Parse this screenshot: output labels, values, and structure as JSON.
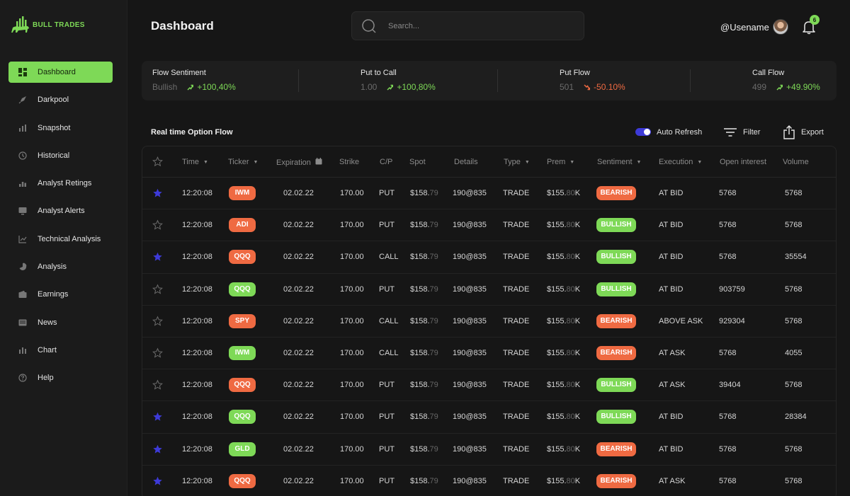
{
  "brand": {
    "name": "BULL TRADES"
  },
  "colors": {
    "accent": "#7ed957",
    "bearish": "#ef6a42",
    "star": "#3d3ad8",
    "toggle": "#3d3ad8"
  },
  "sidebar": {
    "items": [
      {
        "label": "Dashboard",
        "icon": "dashboard-icon",
        "active": true
      },
      {
        "label": "Darkpool",
        "icon": "rocket-icon"
      },
      {
        "label": "Snapshot",
        "icon": "bar-chart-icon"
      },
      {
        "label": "Historical",
        "icon": "clock-icon"
      },
      {
        "label": "Analyst Retings",
        "icon": "analyst-icon"
      },
      {
        "label": "Analyst Alerts",
        "icon": "alert-icon"
      },
      {
        "label": "Technical Analysis",
        "icon": "line-chart-icon"
      },
      {
        "label": "Analysis",
        "icon": "pie-chart-icon"
      },
      {
        "label": "Earnings",
        "icon": "wallet-icon"
      },
      {
        "label": "News",
        "icon": "news-icon"
      },
      {
        "label": "Chart",
        "icon": "chart-icon"
      },
      {
        "label": "Help",
        "icon": "help-icon"
      }
    ]
  },
  "header": {
    "title": "Dashboard",
    "search_placeholder": "Search...",
    "username": "@Usename",
    "notification_count": "6"
  },
  "stats": [
    {
      "label": "Flow Sentiment",
      "value": "Bullish",
      "change": "+100,40%",
      "direction": "up"
    },
    {
      "label": "Put to Call",
      "value": "1.00",
      "change": "+100,80%",
      "direction": "up"
    },
    {
      "label": "Put Flow",
      "value": "501",
      "change": "-50.10%",
      "direction": "down"
    },
    {
      "label": "Call Flow",
      "value": "499",
      "change": "+49.90%",
      "direction": "up"
    }
  ],
  "flow": {
    "title": "Real time Option Flow",
    "auto_refresh_label": "Auto Refresh",
    "auto_refresh_on": true,
    "filter_label": "Filter",
    "export_label": "Export"
  },
  "table": {
    "columns": [
      {
        "label": "",
        "sort": false
      },
      {
        "label": "Time",
        "sort": true
      },
      {
        "label": "Ticker",
        "sort": true
      },
      {
        "label": "Expiration",
        "sort": false,
        "calendar": true
      },
      {
        "label": "Strike",
        "sort": false
      },
      {
        "label": "C/P",
        "sort": false
      },
      {
        "label": "Spot",
        "sort": false
      },
      {
        "label": "Details",
        "sort": false
      },
      {
        "label": "Type",
        "sort": true
      },
      {
        "label": "Prem",
        "sort": true
      },
      {
        "label": "Sentiment",
        "sort": true
      },
      {
        "label": "Execution",
        "sort": true
      },
      {
        "label": "Open interest",
        "sort": false
      },
      {
        "label": "Volume",
        "sort": false
      }
    ],
    "rows": [
      {
        "starred": true,
        "time": "12:20:08",
        "ticker": "IWM",
        "ticker_color": "bearish",
        "expiration": "02.02.22",
        "strike": "170.00",
        "cp": "PUT",
        "spot_main": "$158.",
        "spot_dec": "79",
        "details": "190@835",
        "type": "TRADE",
        "prem_main": "$155.",
        "prem_dec": "80",
        "prem_unit": "K",
        "sentiment": "BEARISH",
        "execution": "AT BID",
        "open_interest": "5768",
        "volume": "5768"
      },
      {
        "starred": false,
        "time": "12:20:08",
        "ticker": "ADI",
        "ticker_color": "bearish",
        "expiration": "02.02.22",
        "strike": "170.00",
        "cp": "PUT",
        "spot_main": "$158.",
        "spot_dec": "79",
        "details": "190@835",
        "type": "TRADE",
        "prem_main": "$155.",
        "prem_dec": "80",
        "prem_unit": "K",
        "sentiment": "BULLISH",
        "execution": "AT BID",
        "open_interest": "5768",
        "volume": "5768"
      },
      {
        "starred": true,
        "time": "12:20:08",
        "ticker": "QQQ",
        "ticker_color": "bearish",
        "expiration": "02.02.22",
        "strike": "170.00",
        "cp": "CALL",
        "spot_main": "$158.",
        "spot_dec": "79",
        "details": "190@835",
        "type": "TRADE",
        "prem_main": "$155.",
        "prem_dec": "80",
        "prem_unit": "K",
        "sentiment": "BULLISH",
        "execution": "AT BID",
        "open_interest": "5768",
        "volume": "35554"
      },
      {
        "starred": false,
        "time": "12:20:08",
        "ticker": "QQQ",
        "ticker_color": "bullish",
        "expiration": "02.02.22",
        "strike": "170.00",
        "cp": "PUT",
        "spot_main": "$158.",
        "spot_dec": "79",
        "details": "190@835",
        "type": "TRADE",
        "prem_main": "$155.",
        "prem_dec": "80",
        "prem_unit": "K",
        "sentiment": "BULLISH",
        "execution": "AT BID",
        "open_interest": "903759",
        "volume": "5768"
      },
      {
        "starred": false,
        "time": "12:20:08",
        "ticker": "SPY",
        "ticker_color": "bearish",
        "expiration": "02.02.22",
        "strike": "170.00",
        "cp": "CALL",
        "spot_main": "$158.",
        "spot_dec": "79",
        "details": "190@835",
        "type": "TRADE",
        "prem_main": "$155.",
        "prem_dec": "80",
        "prem_unit": "K",
        "sentiment": "BEARISH",
        "execution": "ABOVE ASK",
        "open_interest": "929304",
        "volume": "5768"
      },
      {
        "starred": false,
        "time": "12:20:08",
        "ticker": "IWM",
        "ticker_color": "bullish",
        "expiration": "02.02.22",
        "strike": "170.00",
        "cp": "CALL",
        "spot_main": "$158.",
        "spot_dec": "79",
        "details": "190@835",
        "type": "TRADE",
        "prem_main": "$155.",
        "prem_dec": "80",
        "prem_unit": "K",
        "sentiment": "BEARISH",
        "execution": "AT ASK",
        "open_interest": "5768",
        "volume": "4055"
      },
      {
        "starred": false,
        "time": "12:20:08",
        "ticker": "QQQ",
        "ticker_color": "bearish",
        "expiration": "02.02.22",
        "strike": "170.00",
        "cp": "PUT",
        "spot_main": "$158.",
        "spot_dec": "79",
        "details": "190@835",
        "type": "TRADE",
        "prem_main": "$155.",
        "prem_dec": "80",
        "prem_unit": "K",
        "sentiment": "BULLISH",
        "execution": "AT ASK",
        "open_interest": "39404",
        "volume": "5768"
      },
      {
        "starred": true,
        "time": "12:20:08",
        "ticker": "QQQ",
        "ticker_color": "bullish",
        "expiration": "02.02.22",
        "strike": "170.00",
        "cp": "PUT",
        "spot_main": "$158.",
        "spot_dec": "79",
        "details": "190@835",
        "type": "TRADE",
        "prem_main": "$155.",
        "prem_dec": "80",
        "prem_unit": "K",
        "sentiment": "BULLISH",
        "execution": "AT BID",
        "open_interest": "5768",
        "volume": "28384"
      },
      {
        "starred": true,
        "time": "12:20:08",
        "ticker": "GLD",
        "ticker_color": "bullish",
        "expiration": "02.02.22",
        "strike": "170.00",
        "cp": "PUT",
        "spot_main": "$158.",
        "spot_dec": "79",
        "details": "190@835",
        "type": "TRADE",
        "prem_main": "$155.",
        "prem_dec": "80",
        "prem_unit": "K",
        "sentiment": "BEARISH",
        "execution": "AT BID",
        "open_interest": "5768",
        "volume": "5768"
      },
      {
        "starred": true,
        "time": "12:20:08",
        "ticker": "QQQ",
        "ticker_color": "bearish",
        "expiration": "02.02.22",
        "strike": "170.00",
        "cp": "PUT",
        "spot_main": "$158.",
        "spot_dec": "79",
        "details": "190@835",
        "type": "TRADE",
        "prem_main": "$155.",
        "prem_dec": "80",
        "prem_unit": "K",
        "sentiment": "BEARISH",
        "execution": "AT ASK",
        "open_interest": "5768",
        "volume": "5768"
      }
    ]
  }
}
